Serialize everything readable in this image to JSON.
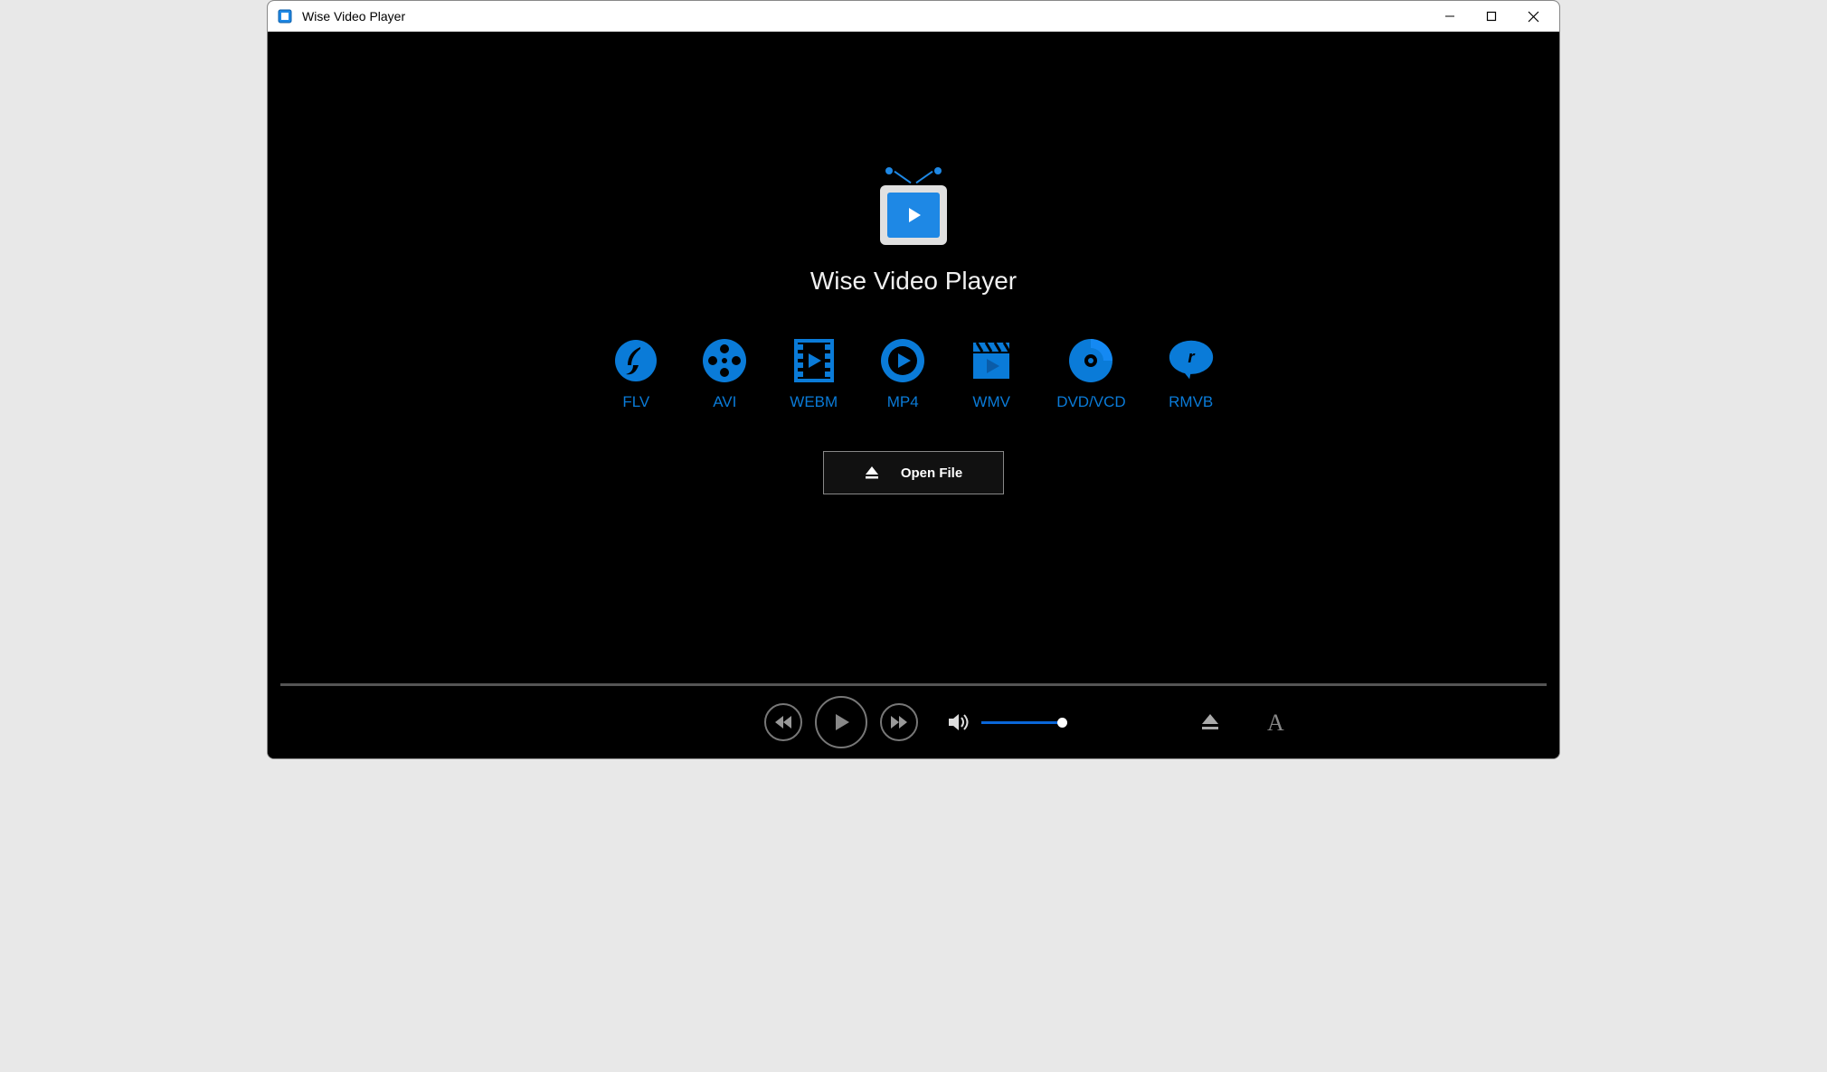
{
  "window": {
    "title": "Wise Video Player"
  },
  "main": {
    "app_name": "Wise Video Player",
    "formats": [
      {
        "label": "FLV"
      },
      {
        "label": "AVI"
      },
      {
        "label": "WEBM"
      },
      {
        "label": "MP4"
      },
      {
        "label": "WMV"
      },
      {
        "label": "DVD/VCD"
      },
      {
        "label": "RMVB"
      }
    ],
    "open_file_label": "Open File"
  },
  "controls": {
    "volume_percent": 100
  },
  "colors": {
    "accent_blue": "#0a7bd8",
    "logo_blue": "#1e88e5"
  }
}
